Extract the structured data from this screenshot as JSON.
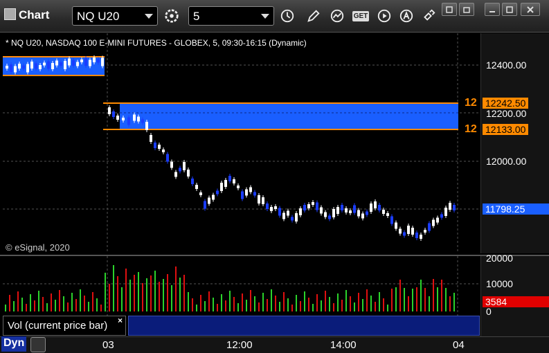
{
  "toolbar": {
    "title": "Chart",
    "symbol_value": "NQ U20",
    "interval_value": "5",
    "get_label": "GET"
  },
  "chart": {
    "header": "* NQ U20, NASDAQ 100 E-MINI FUTURES - GLOBEX, 5, 09:30-16:15 (Dynamic)",
    "copyright": "© eSignal, 2020",
    "price_labels": [
      "12400.00",
      "12200.00",
      "12000.00"
    ],
    "level_upper": "12242.50",
    "level_lower": "12133.00",
    "last_price": "11798.25",
    "alert_upper": "12",
    "alert_lower": "12"
  },
  "volume": {
    "labels": [
      "20000",
      "10000",
      "0"
    ],
    "current": "3584",
    "study_label": "Vol (current price bar)",
    "close_symbol": "×"
  },
  "time_axis": {
    "labels": [
      "03",
      "12:00",
      "14:00",
      "04"
    ],
    "dyn_label": "Dyn"
  },
  "colors": {
    "up_bar": "#ffffff",
    "down_bar": "#1a3cff",
    "zone_fill": "#1a5fff",
    "zone_line": "#ff8a00",
    "vol_up": "#2bd32b",
    "vol_down": "#e01010"
  }
}
